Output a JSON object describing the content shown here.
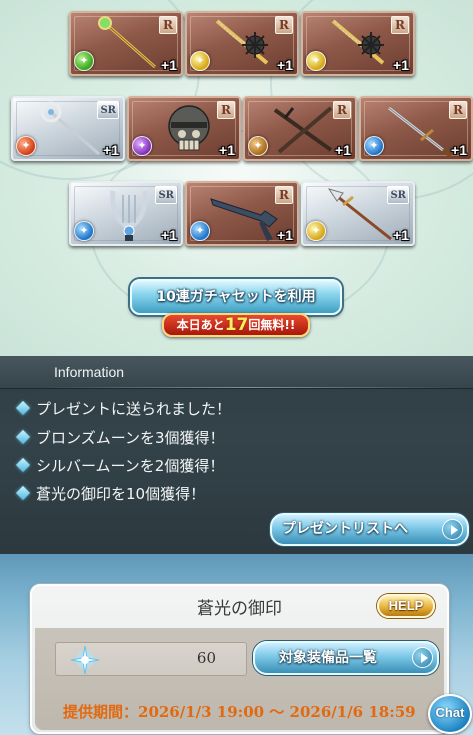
{
  "cards": [
    {
      "rarity": "R",
      "element": "wind",
      "weapon": "staff-icon",
      "count": "+1"
    },
    {
      "rarity": "R",
      "element": "light",
      "weapon": "mace-icon",
      "count": "+1"
    },
    {
      "rarity": "R",
      "element": "light",
      "weapon": "mace-icon",
      "count": "+1"
    },
    {
      "rarity": "SR",
      "element": "fire",
      "weapon": "staff-icon",
      "count": "+1"
    },
    {
      "rarity": "R",
      "element": "dark",
      "weapon": "skull-helmet-icon",
      "count": "+1"
    },
    {
      "rarity": "R",
      "element": "earth",
      "weapon": "crossed-blades-icon",
      "count": "+1"
    },
    {
      "rarity": "R",
      "element": "water",
      "weapon": "sword-icon",
      "count": "+1"
    },
    {
      "rarity": "SR",
      "element": "water",
      "weapon": "harp-icon",
      "count": "+1"
    },
    {
      "rarity": "R",
      "element": "water",
      "weapon": "gun-icon",
      "count": "+1"
    },
    {
      "rarity": "SR",
      "element": "light",
      "weapon": "spear-icon",
      "count": "+1"
    }
  ],
  "gacha": {
    "draw_button_label": "10連ガチャセットを利用",
    "free_prefix": "本日あと",
    "free_count": "17",
    "free_suffix": "回無料!!"
  },
  "information": {
    "title": "Information",
    "items": [
      "プレゼントに送られました！",
      "ブロンズムーンを3個獲得！",
      "シルバームーンを2個獲得！",
      "蒼光の御印を10個獲得！"
    ],
    "present_list_button": "プレゼントリストへ"
  },
  "item_section": {
    "title": "蒼光の御印",
    "help_label": "HELP",
    "count": "60",
    "target_button": "対象装備品一覧",
    "period_label": "提供期間：2026/1/3 19:00 〜 2026/1/6 18:59"
  },
  "chat_label": "Chat",
  "colors": {
    "info_bg": "#34434a",
    "button_blue": "#7cc8e6",
    "badge_red": "#c0240f",
    "period_orange": "#e2690f"
  }
}
